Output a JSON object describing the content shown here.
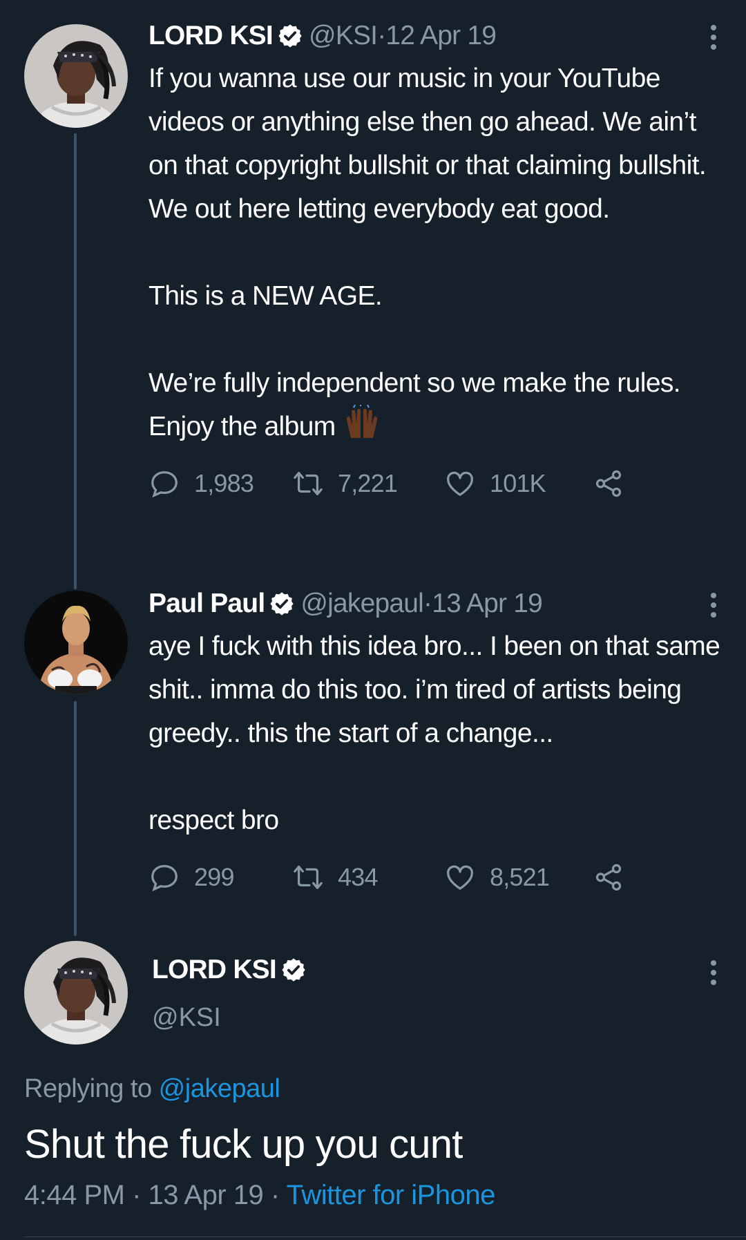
{
  "tweets": [
    {
      "name": "LORD KSI",
      "handle": "@KSI",
      "date": "12 Apr 19",
      "text": "If you wanna use our music in your YouTube videos or anything else then go ahead. We ain’t on that copyright bullshit or that claiming bullshit. We out here letting everybody eat good.\n\nThis is a NEW AGE.\n\nWe’re fully independent so we make the rules. Enjoy the album",
      "emoji": "raising-hands-emoji",
      "replies": "1,983",
      "retweets": "7,221",
      "likes": "101K"
    },
    {
      "name": "Paul Paul",
      "handle": "@jakepaul",
      "date": "13 Apr 19",
      "text": "aye I fuck with this idea bro... I been on that same shit.. imma do this too. i’m tired of artists being greedy.. this the start of a change...\n\nrespect bro",
      "replies": "299",
      "retweets": "434",
      "likes": "8,521"
    }
  ],
  "main_tweet": {
    "name": "LORD KSI",
    "handle": "@KSI",
    "replying_prefix": "Replying to ",
    "replying_to": "@jakepaul",
    "text": "Shut the fuck up you cunt",
    "time": "4:44 PM",
    "date": "13 Apr 19",
    "source": "Twitter for iPhone"
  },
  "separator": " · ",
  "colors": {
    "background": "#15202b",
    "secondary_text": "#8899a6",
    "link": "#1b95e0",
    "thread_line": "#3d5466"
  },
  "icons": [
    "reply-icon",
    "retweet-icon",
    "like-icon",
    "share-icon",
    "more-icon",
    "verified-badge-icon"
  ]
}
